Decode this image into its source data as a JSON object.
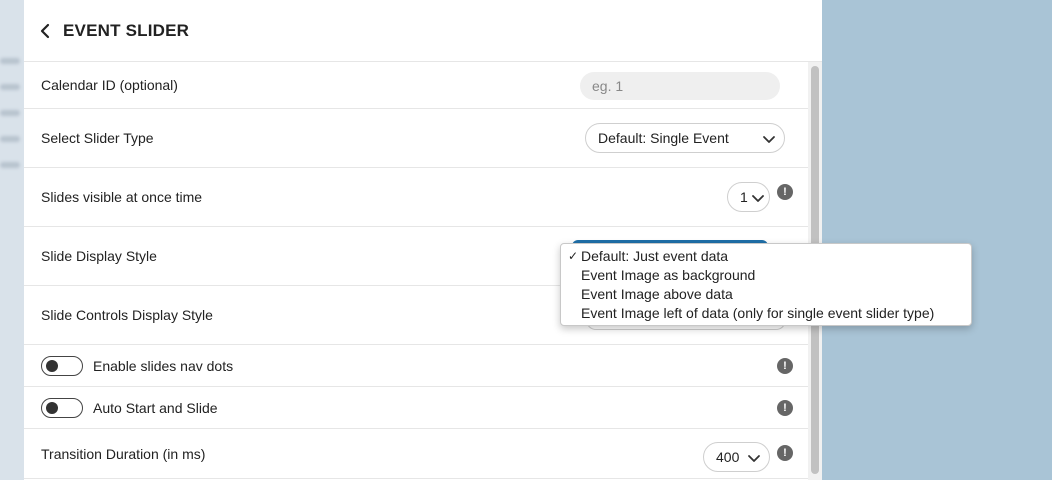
{
  "header": {
    "title": "EVENT SLIDER",
    "back_icon": "chevron-left-icon"
  },
  "fields": {
    "calendar_id": {
      "label": "Calendar ID (optional)",
      "placeholder": "eg. 1",
      "value": ""
    },
    "slider_type": {
      "label": "Select Slider Type",
      "selected": "Default: Single Event"
    },
    "slides_visible": {
      "label": "Slides visible at once time",
      "selected": "1",
      "info_icon": "!"
    },
    "display_style": {
      "label": "Slide Display Style",
      "options": [
        {
          "label": "Default: Just event data",
          "selected": true
        },
        {
          "label": "Event Image as background",
          "selected": false
        },
        {
          "label": "Event Image above data",
          "selected": false
        },
        {
          "label": "Event Image left of data (only for single event slider type)",
          "selected": false
        }
      ],
      "check_mark": "✓"
    },
    "controls_style": {
      "label": "Slide Controls Display Style"
    },
    "nav_dots": {
      "label": "Enable slides nav dots",
      "enabled": false,
      "info_icon": "!"
    },
    "auto_start": {
      "label": "Auto Start and Slide",
      "enabled": false,
      "info_icon": "!"
    },
    "transition_duration": {
      "label": "Transition Duration (in ms)",
      "selected": "400",
      "info_icon": "!"
    }
  },
  "colors": {
    "backdrop": "#a9c4d6",
    "accent": "#1f6fa8",
    "panel": "#ffffff"
  }
}
